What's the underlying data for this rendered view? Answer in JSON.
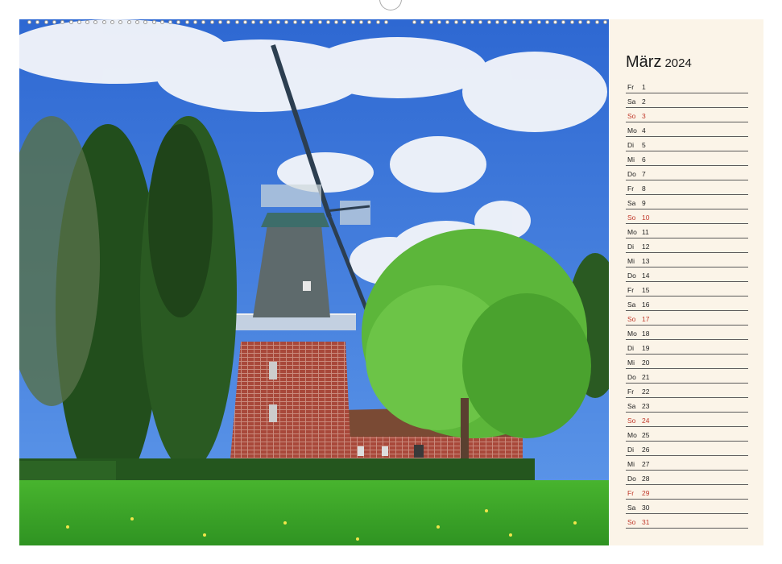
{
  "calendar": {
    "month": "März",
    "year": "2024",
    "days": [
      {
        "wd": "Fr",
        "d": "1",
        "red": false
      },
      {
        "wd": "Sa",
        "d": "2",
        "red": false
      },
      {
        "wd": "So",
        "d": "3",
        "red": true
      },
      {
        "wd": "Mo",
        "d": "4",
        "red": false
      },
      {
        "wd": "Di",
        "d": "5",
        "red": false
      },
      {
        "wd": "Mi",
        "d": "6",
        "red": false
      },
      {
        "wd": "Do",
        "d": "7",
        "red": false
      },
      {
        "wd": "Fr",
        "d": "8",
        "red": false
      },
      {
        "wd": "Sa",
        "d": "9",
        "red": false
      },
      {
        "wd": "So",
        "d": "10",
        "red": true
      },
      {
        "wd": "Mo",
        "d": "11",
        "red": false
      },
      {
        "wd": "Di",
        "d": "12",
        "red": false
      },
      {
        "wd": "Mi",
        "d": "13",
        "red": false
      },
      {
        "wd": "Do",
        "d": "14",
        "red": false
      },
      {
        "wd": "Fr",
        "d": "15",
        "red": false
      },
      {
        "wd": "Sa",
        "d": "16",
        "red": false
      },
      {
        "wd": "So",
        "d": "17",
        "red": true
      },
      {
        "wd": "Mo",
        "d": "18",
        "red": false
      },
      {
        "wd": "Di",
        "d": "19",
        "red": false
      },
      {
        "wd": "Mi",
        "d": "20",
        "red": false
      },
      {
        "wd": "Do",
        "d": "21",
        "red": false
      },
      {
        "wd": "Fr",
        "d": "22",
        "red": false
      },
      {
        "wd": "Sa",
        "d": "23",
        "red": false
      },
      {
        "wd": "So",
        "d": "24",
        "red": true
      },
      {
        "wd": "Mo",
        "d": "25",
        "red": false
      },
      {
        "wd": "Di",
        "d": "26",
        "red": false
      },
      {
        "wd": "Mi",
        "d": "27",
        "red": false
      },
      {
        "wd": "Do",
        "d": "28",
        "red": false
      },
      {
        "wd": "Fr",
        "d": "29",
        "red": true
      },
      {
        "wd": "Sa",
        "d": "30",
        "red": false
      },
      {
        "wd": "So",
        "d": "31",
        "red": true
      }
    ]
  },
  "colors": {
    "holiday_red": "#c0392b",
    "panel_background": "#fbf4e8",
    "sky": "#2f6fd6",
    "grass": "#3fae2a"
  }
}
